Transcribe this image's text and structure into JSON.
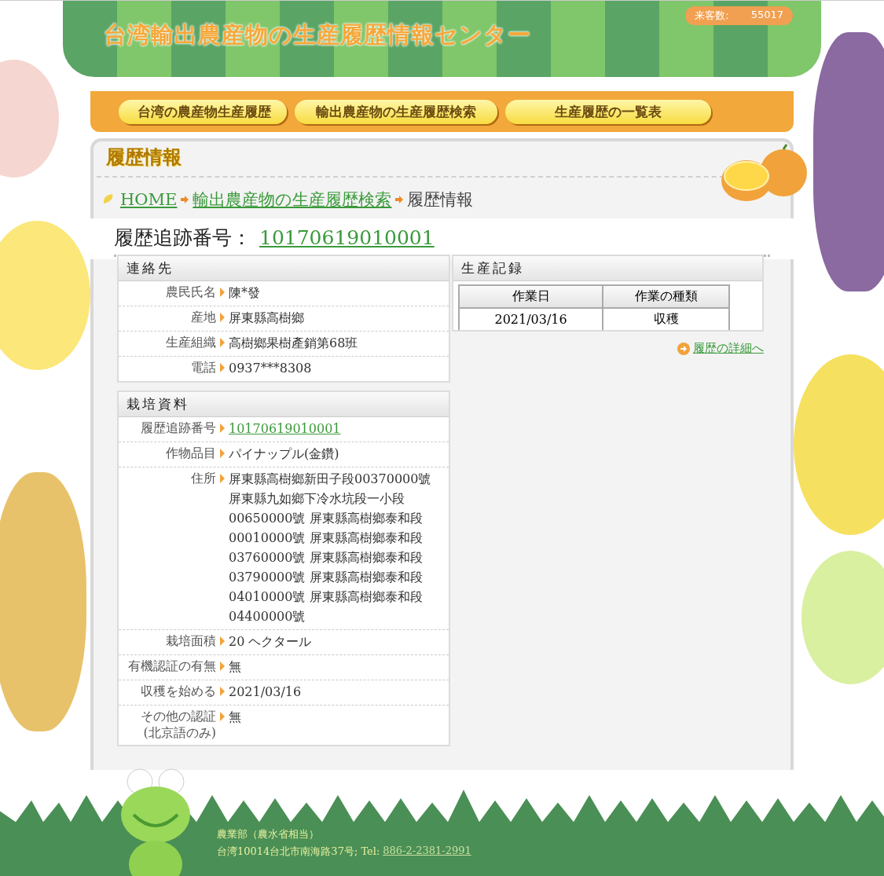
{
  "header": {
    "title": "台湾輸出農産物の生産履歴情報センター",
    "visitor_label": "来客数:",
    "visitor_count": "55017"
  },
  "nav": [
    {
      "label": "台湾の農産物生産履歴"
    },
    {
      "label": "輸出農産物の生産履歴検索"
    },
    {
      "label": "生産履歴の一覧表"
    }
  ],
  "section_title": "履歴情報",
  "breadcrumb": [
    {
      "label": "HOME",
      "link": true
    },
    {
      "label": "輸出農産物の生産履歴検索",
      "link": true
    },
    {
      "label": "履歴情報",
      "link": false
    }
  ],
  "trace": {
    "label": "履歴追跡番号：",
    "number": "10170619010001"
  },
  "contact": {
    "title": "連絡先",
    "rows": [
      {
        "label": "農民氏名",
        "value": "陳*發",
        "link": false
      },
      {
        "label": "産地",
        "value": "屏東縣高樹鄉",
        "link": false
      },
      {
        "label": "生産組織",
        "value": "高樹鄉果樹產銷第68班",
        "link": false
      },
      {
        "label": "電話",
        "value": "0937***8308",
        "link": false
      }
    ]
  },
  "cultivation": {
    "title": "栽培資料",
    "rows": [
      {
        "label": "履歴追跡番号",
        "value": "10170619010001",
        "link": true
      },
      {
        "label": "作物品目",
        "value": "パイナップル(金鑽)",
        "link": false
      },
      {
        "label": "住所",
        "value": "屏東縣高樹鄉新田子段00370000號屏東縣九如鄉下冷水坑段一小段00650000號 屏東縣高樹鄉泰和段00010000號 屏東縣高樹鄉泰和段03760000號 屏東縣高樹鄉泰和段03790000號 屏東縣高樹鄉泰和段04010000號 屏東縣高樹鄉泰和段04400000號",
        "link": false
      },
      {
        "label": "栽培面積",
        "value": "20 ヘクタール",
        "link": false
      },
      {
        "label": "有機認証の有無",
        "value": "無",
        "link": false
      },
      {
        "label": "収穫を始める",
        "value": "2021/03/16",
        "link": false
      },
      {
        "label": "その他の認証",
        "note": "(北京語のみ)",
        "value": "無",
        "link": false
      }
    ]
  },
  "production": {
    "title": "生産記録",
    "columns": [
      "作業日",
      "作業の種類"
    ],
    "rows": [
      [
        "2021/03/16",
        "収穫"
      ]
    ],
    "detail_link": "履歴の詳細へ"
  },
  "footer": {
    "org": "農業部（農水省相当）",
    "address": "台湾10014台北市南海路37号; Tel:",
    "tel": "886-2-2381-2991"
  }
}
